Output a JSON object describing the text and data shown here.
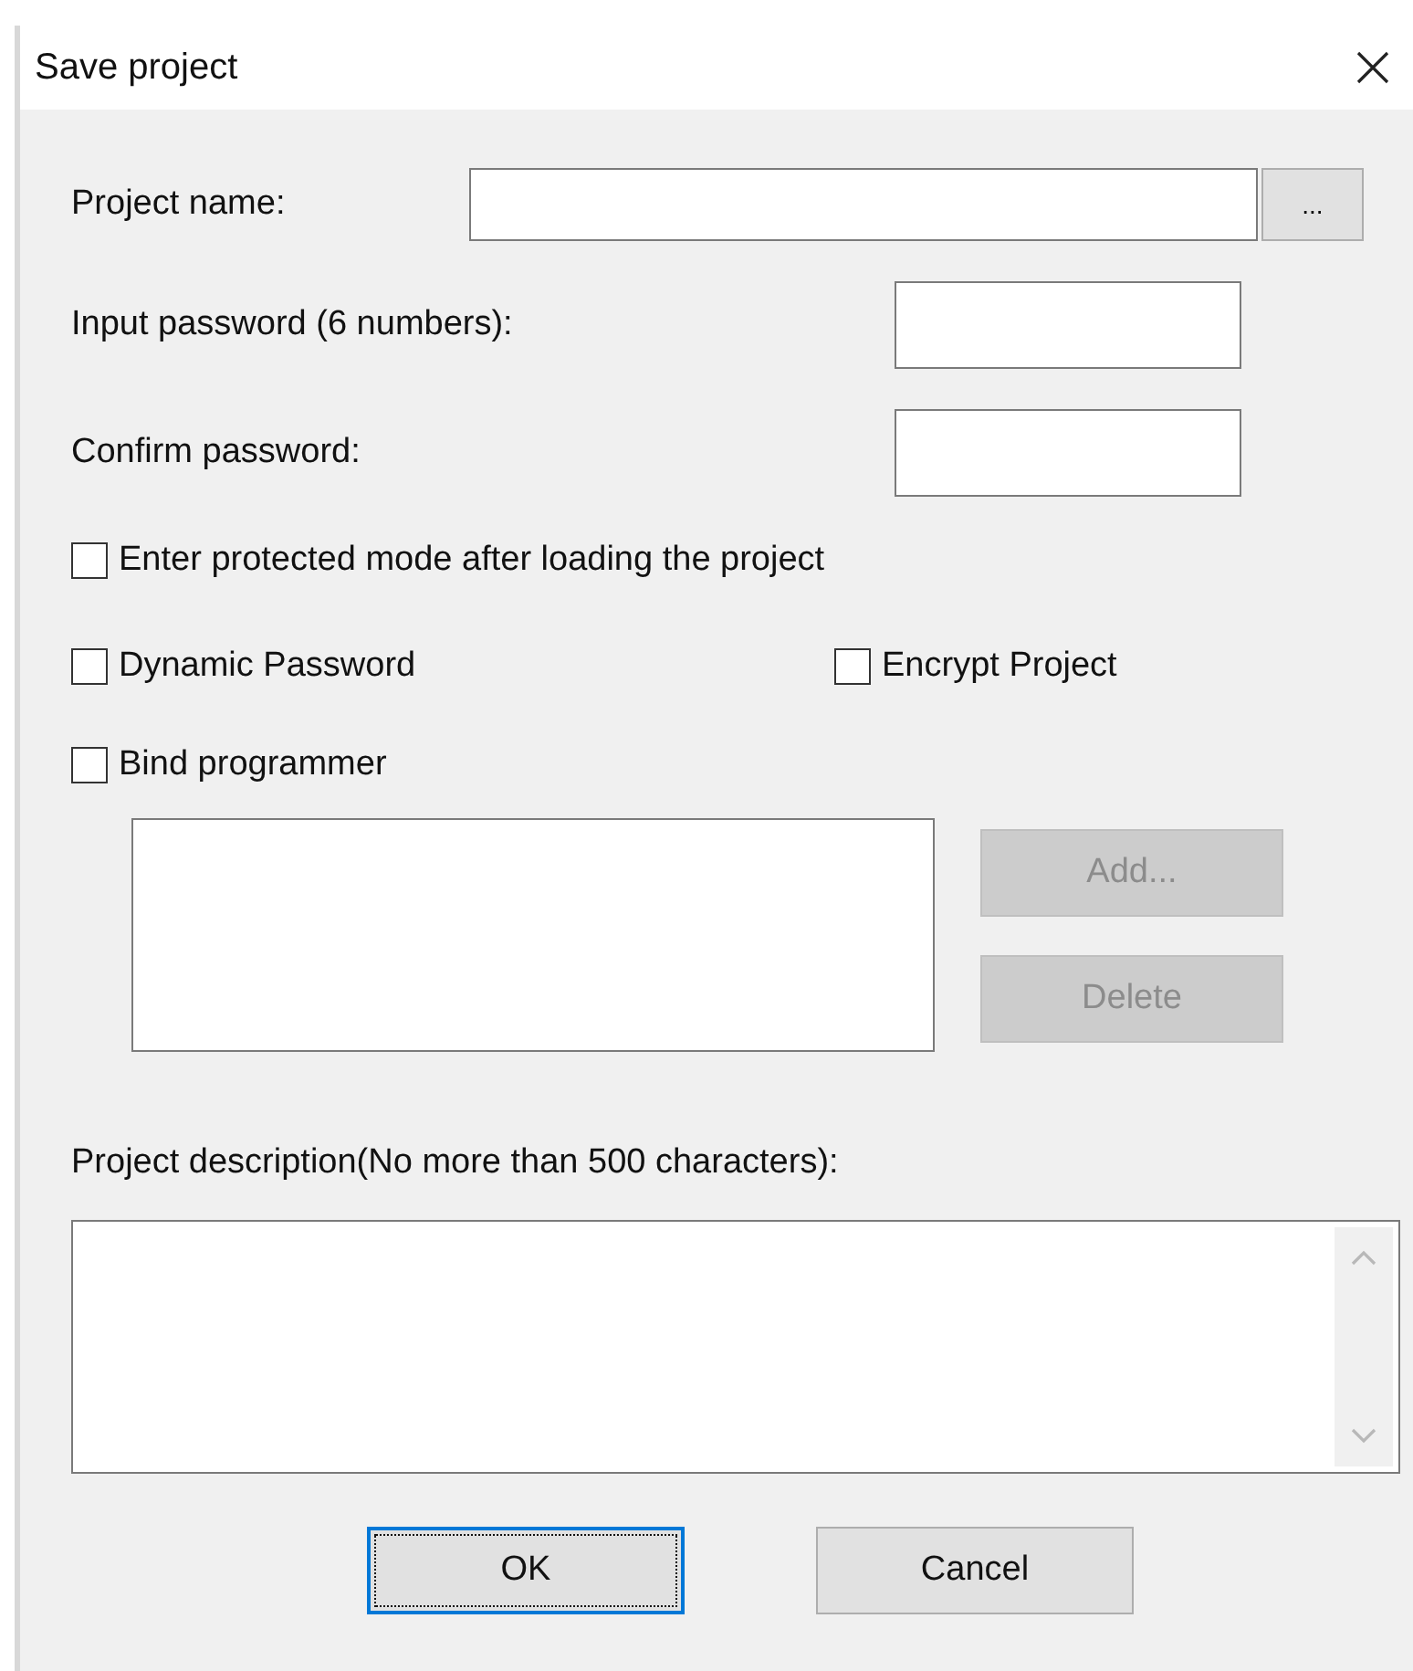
{
  "window": {
    "title": "Save project"
  },
  "project_name": {
    "label": "Project name:",
    "browse": "..."
  },
  "passwords": [
    {
      "label": "Input password (6 numbers):"
    },
    {
      "label": "Confirm password:"
    }
  ],
  "options": [
    {
      "label": "Enter protected mode after loading the project",
      "checked": false
    },
    {
      "label": "Dynamic Password",
      "checked": false
    },
    {
      "label": "Encrypt Project",
      "checked": false
    },
    {
      "label": "Bind programmer",
      "checked": false
    }
  ],
  "programmer_buttons": [
    {
      "label": "Add...",
      "disabled": true
    },
    {
      "label": "Delete",
      "disabled": true
    }
  ],
  "description": {
    "label": "Project description(No more than 500 characters):"
  },
  "buttons": [
    {
      "label": "OK",
      "default": true
    },
    {
      "label": "Cancel",
      "default": false
    }
  ]
}
